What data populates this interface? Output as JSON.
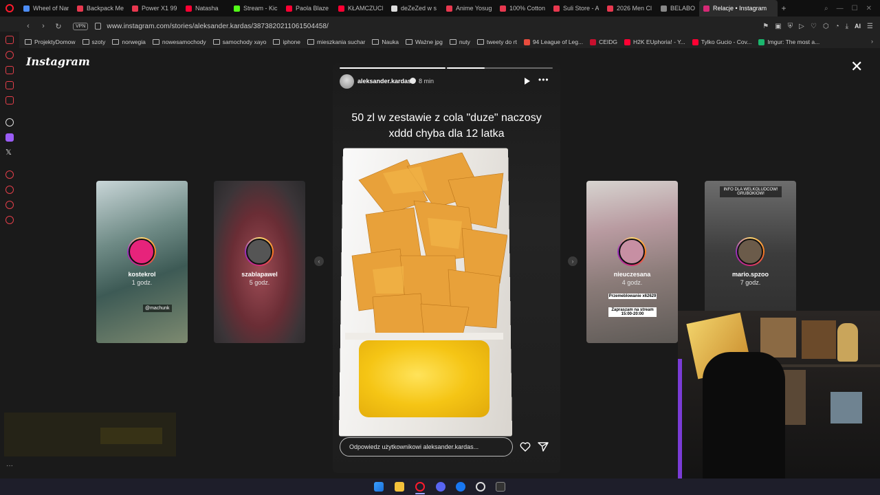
{
  "browser": {
    "tabs": [
      {
        "title": "Wheel of Nan",
        "color": "#4c8cf5"
      },
      {
        "title": "Backpack Me",
        "color": "#e8384f"
      },
      {
        "title": "Power X1 99",
        "color": "#e8384f"
      },
      {
        "title": "Natasha",
        "color": "#ff0033"
      },
      {
        "title": "Stream - Kic",
        "color": "#53fc18"
      },
      {
        "title": "Paola Blaze",
        "color": "#ff0033"
      },
      {
        "title": "KŁAMCZUCI",
        "color": "#ff0033"
      },
      {
        "title": "deZeZed w s",
        "color": "#dddddd"
      },
      {
        "title": "Anime Yosug",
        "color": "#e8384f"
      },
      {
        "title": "100% Cotton",
        "color": "#e8384f"
      },
      {
        "title": "Suli Store - A",
        "color": "#e8384f"
      },
      {
        "title": "2026 Men Cl",
        "color": "#e8384f"
      },
      {
        "title": "BELABOX cl",
        "color": "#888888"
      },
      {
        "title": "Relacje • Instagram",
        "color": "#d62976",
        "active": true
      }
    ],
    "new_tab_label": "+",
    "url": "www.instagram.com/stories/aleksander.kardas/3873820211061504458/",
    "vpn_label": "VPN",
    "ai_label": "AI",
    "bookmarks": [
      {
        "label": "ProjektyDomow",
        "type": "folder"
      },
      {
        "label": "szoty",
        "type": "folder"
      },
      {
        "label": "norwegia",
        "type": "folder"
      },
      {
        "label": "nowesamochody",
        "type": "folder"
      },
      {
        "label": "samochody xayo",
        "type": "folder"
      },
      {
        "label": "iphone",
        "type": "folder"
      },
      {
        "label": "mieszkania suchar",
        "type": "folder"
      },
      {
        "label": "Nauka",
        "type": "folder"
      },
      {
        "label": "Ważne jpg",
        "type": "folder"
      },
      {
        "label": "nuty",
        "type": "folder"
      },
      {
        "label": "tweety do rt",
        "type": "folder"
      },
      {
        "label": "94 League of Leg...",
        "type": "link",
        "color": "#e84c3d"
      },
      {
        "label": "CEIDG",
        "type": "link",
        "color": "#c8102e"
      },
      {
        "label": "H2K EUphoria! - Y...",
        "type": "link",
        "color": "#ff0033"
      },
      {
        "label": "Tylko Gucio - Cov...",
        "type": "link",
        "color": "#ff0033"
      },
      {
        "label": "Imgur: The most a...",
        "type": "link",
        "color": "#1bb76e"
      }
    ]
  },
  "instagram": {
    "logo": "Instagram",
    "close_icon": "close-icon",
    "previews": [
      {
        "username": "kostekrol",
        "time": "1 godz.",
        "tag": "@machunk"
      },
      {
        "username": "szablapawel",
        "time": "5 godz."
      },
      {
        "username": "nieuczesana",
        "time": "4 godz.",
        "banner1": "Przemeblowanie x62629",
        "banner2": "Zapraszam na stream 15:00-20:00"
      },
      {
        "username": "mario.spzoo",
        "time": "7 godz.",
        "banner": "INFO DLA WELKOLUDCOW! GRUBOKIOW!"
      }
    ],
    "story": {
      "username": "aleksander.kardas",
      "time": "8 min",
      "caption_line1": "50 zl w zestawie z cola \"duze\" naczosy",
      "caption_line2": "xddd chyba dla 12 latka",
      "reply_placeholder": "Odpowiedz użytkownikowi aleksander.kardas...",
      "progress": [
        1.0,
        1.0,
        0.35
      ]
    }
  },
  "colors": {
    "accent": "#ff1b2d",
    "instagram_gradient": "#d62976",
    "cheese": "#f5c515"
  }
}
